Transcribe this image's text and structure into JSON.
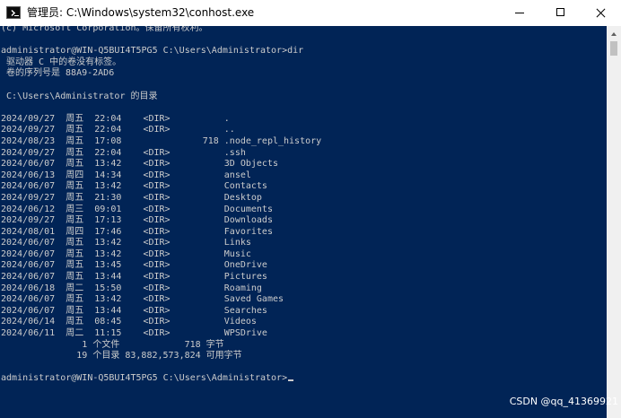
{
  "window": {
    "title": "管理员: C:\\Windows\\system32\\conhost.exe",
    "icon": "console-icon",
    "controls": {
      "minimize": "minimize-icon",
      "maximize": "maximize-icon",
      "close": "close-icon"
    }
  },
  "colors": {
    "console_bg": "#012456",
    "console_fg": "#cccccc",
    "titlebar_bg": "#ffffff"
  },
  "console": {
    "lines": [
      "(c) Microsoft Corporation。保留所有权利。",
      "",
      "administrator@WIN-Q5BUI4T5PG5 C:\\Users\\Administrator>dir",
      " 驱动器 C 中的卷没有标签。",
      " 卷的序列号是 88A9-2AD6",
      "",
      " C:\\Users\\Administrator 的目录",
      "",
      "2024/09/27  周五  22:04    <DIR>          .",
      "2024/09/27  周五  22:04    <DIR>          ..",
      "2024/08/23  周五  17:08               718 .node_repl_history",
      "2024/09/27  周五  22:04    <DIR>          .ssh",
      "2024/06/07  周五  13:42    <DIR>          3D Objects",
      "2024/06/13  周四  14:34    <DIR>          ansel",
      "2024/06/07  周五  13:42    <DIR>          Contacts",
      "2024/09/27  周五  21:30    <DIR>          Desktop",
      "2024/06/12  周三  09:01    <DIR>          Documents",
      "2024/09/27  周五  17:13    <DIR>          Downloads",
      "2024/08/01  周四  17:46    <DIR>          Favorites",
      "2024/06/07  周五  13:42    <DIR>          Links",
      "2024/06/07  周五  13:42    <DIR>          Music",
      "2024/06/07  周五  13:45    <DIR>          OneDrive",
      "2024/06/07  周五  13:44    <DIR>          Pictures",
      "2024/06/18  周二  15:50    <DIR>          Roaming",
      "2024/06/07  周五  13:42    <DIR>          Saved Games",
      "2024/06/07  周五  13:44    <DIR>          Searches",
      "2024/06/14  周五  08:45    <DIR>          Videos",
      "2024/06/11  周二  11:15    <DIR>          WPSDrive",
      "               1 个文件            718 字节",
      "              19 个目录 83,882,573,824 可用字节",
      "",
      "administrator@WIN-Q5BUI4T5PG5 C:\\Users\\Administrator>"
    ]
  },
  "watermark": "CSDN @qq_41369921"
}
